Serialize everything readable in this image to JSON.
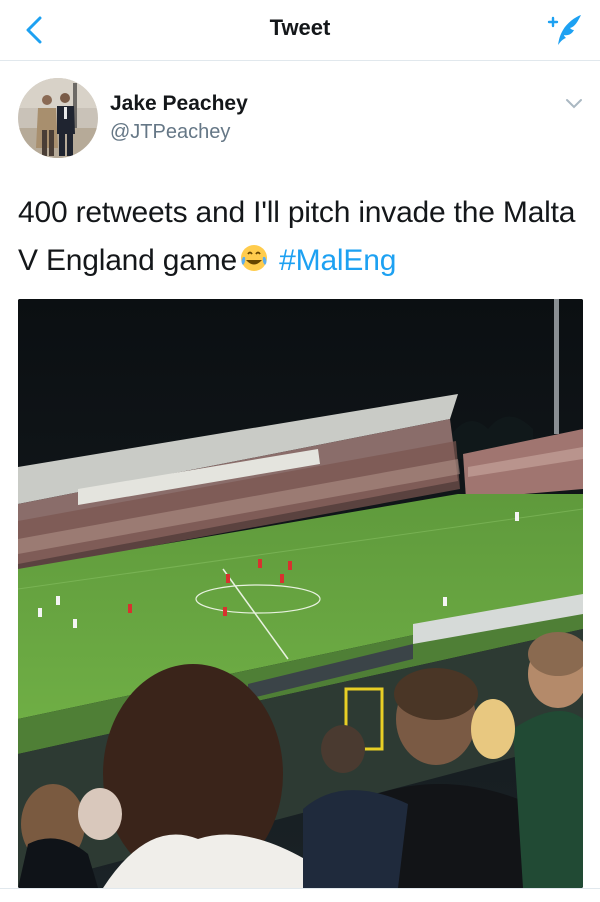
{
  "nav": {
    "title": "Tweet",
    "back_icon": "chevron-left-icon",
    "compose_icon": "compose-tweet-icon",
    "accent": "#1da1f2"
  },
  "tweet": {
    "author": {
      "display_name": "Jake Peachey",
      "handle": "@JTPeachey"
    },
    "text_main": "400 retweets and I'll pitch invade the Malta V England game",
    "emoji": "face-with-tears-of-joy",
    "hashtag": "#MalEng",
    "media_description_icon": "photo-stadium"
  },
  "colors": {
    "text": "#14171a",
    "secondary": "#657786",
    "hashtag": "#1da1f2",
    "divider": "#e1e8ed"
  }
}
